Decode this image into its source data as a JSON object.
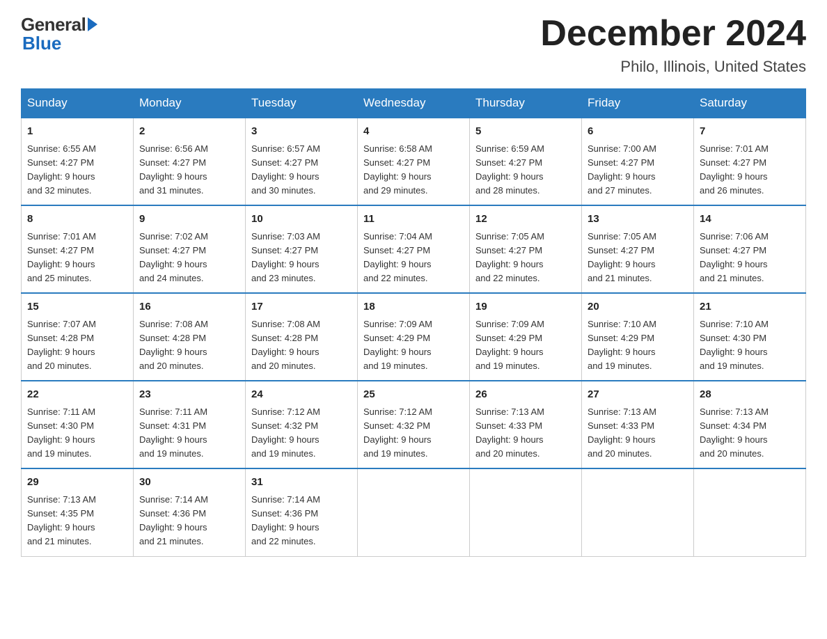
{
  "header": {
    "logo_general": "General",
    "logo_blue": "Blue",
    "month_title": "December 2024",
    "location": "Philo, Illinois, United States"
  },
  "days_of_week": [
    "Sunday",
    "Monday",
    "Tuesday",
    "Wednesday",
    "Thursday",
    "Friday",
    "Saturday"
  ],
  "weeks": [
    [
      {
        "num": "1",
        "sunrise": "6:55 AM",
        "sunset": "4:27 PM",
        "daylight": "9 hours and 32 minutes."
      },
      {
        "num": "2",
        "sunrise": "6:56 AM",
        "sunset": "4:27 PM",
        "daylight": "9 hours and 31 minutes."
      },
      {
        "num": "3",
        "sunrise": "6:57 AM",
        "sunset": "4:27 PM",
        "daylight": "9 hours and 30 minutes."
      },
      {
        "num": "4",
        "sunrise": "6:58 AM",
        "sunset": "4:27 PM",
        "daylight": "9 hours and 29 minutes."
      },
      {
        "num": "5",
        "sunrise": "6:59 AM",
        "sunset": "4:27 PM",
        "daylight": "9 hours and 28 minutes."
      },
      {
        "num": "6",
        "sunrise": "7:00 AM",
        "sunset": "4:27 PM",
        "daylight": "9 hours and 27 minutes."
      },
      {
        "num": "7",
        "sunrise": "7:01 AM",
        "sunset": "4:27 PM",
        "daylight": "9 hours and 26 minutes."
      }
    ],
    [
      {
        "num": "8",
        "sunrise": "7:01 AM",
        "sunset": "4:27 PM",
        "daylight": "9 hours and 25 minutes."
      },
      {
        "num": "9",
        "sunrise": "7:02 AM",
        "sunset": "4:27 PM",
        "daylight": "9 hours and 24 minutes."
      },
      {
        "num": "10",
        "sunrise": "7:03 AM",
        "sunset": "4:27 PM",
        "daylight": "9 hours and 23 minutes."
      },
      {
        "num": "11",
        "sunrise": "7:04 AM",
        "sunset": "4:27 PM",
        "daylight": "9 hours and 22 minutes."
      },
      {
        "num": "12",
        "sunrise": "7:05 AM",
        "sunset": "4:27 PM",
        "daylight": "9 hours and 22 minutes."
      },
      {
        "num": "13",
        "sunrise": "7:05 AM",
        "sunset": "4:27 PM",
        "daylight": "9 hours and 21 minutes."
      },
      {
        "num": "14",
        "sunrise": "7:06 AM",
        "sunset": "4:27 PM",
        "daylight": "9 hours and 21 minutes."
      }
    ],
    [
      {
        "num": "15",
        "sunrise": "7:07 AM",
        "sunset": "4:28 PM",
        "daylight": "9 hours and 20 minutes."
      },
      {
        "num": "16",
        "sunrise": "7:08 AM",
        "sunset": "4:28 PM",
        "daylight": "9 hours and 20 minutes."
      },
      {
        "num": "17",
        "sunrise": "7:08 AM",
        "sunset": "4:28 PM",
        "daylight": "9 hours and 20 minutes."
      },
      {
        "num": "18",
        "sunrise": "7:09 AM",
        "sunset": "4:29 PM",
        "daylight": "9 hours and 19 minutes."
      },
      {
        "num": "19",
        "sunrise": "7:09 AM",
        "sunset": "4:29 PM",
        "daylight": "9 hours and 19 minutes."
      },
      {
        "num": "20",
        "sunrise": "7:10 AM",
        "sunset": "4:29 PM",
        "daylight": "9 hours and 19 minutes."
      },
      {
        "num": "21",
        "sunrise": "7:10 AM",
        "sunset": "4:30 PM",
        "daylight": "9 hours and 19 minutes."
      }
    ],
    [
      {
        "num": "22",
        "sunrise": "7:11 AM",
        "sunset": "4:30 PM",
        "daylight": "9 hours and 19 minutes."
      },
      {
        "num": "23",
        "sunrise": "7:11 AM",
        "sunset": "4:31 PM",
        "daylight": "9 hours and 19 minutes."
      },
      {
        "num": "24",
        "sunrise": "7:12 AM",
        "sunset": "4:32 PM",
        "daylight": "9 hours and 19 minutes."
      },
      {
        "num": "25",
        "sunrise": "7:12 AM",
        "sunset": "4:32 PM",
        "daylight": "9 hours and 19 minutes."
      },
      {
        "num": "26",
        "sunrise": "7:13 AM",
        "sunset": "4:33 PM",
        "daylight": "9 hours and 20 minutes."
      },
      {
        "num": "27",
        "sunrise": "7:13 AM",
        "sunset": "4:33 PM",
        "daylight": "9 hours and 20 minutes."
      },
      {
        "num": "28",
        "sunrise": "7:13 AM",
        "sunset": "4:34 PM",
        "daylight": "9 hours and 20 minutes."
      }
    ],
    [
      {
        "num": "29",
        "sunrise": "7:13 AM",
        "sunset": "4:35 PM",
        "daylight": "9 hours and 21 minutes."
      },
      {
        "num": "30",
        "sunrise": "7:14 AM",
        "sunset": "4:36 PM",
        "daylight": "9 hours and 21 minutes."
      },
      {
        "num": "31",
        "sunrise": "7:14 AM",
        "sunset": "4:36 PM",
        "daylight": "9 hours and 22 minutes."
      },
      null,
      null,
      null,
      null
    ]
  ],
  "labels": {
    "sunrise_prefix": "Sunrise: ",
    "sunset_prefix": "Sunset: ",
    "daylight_prefix": "Daylight: "
  }
}
